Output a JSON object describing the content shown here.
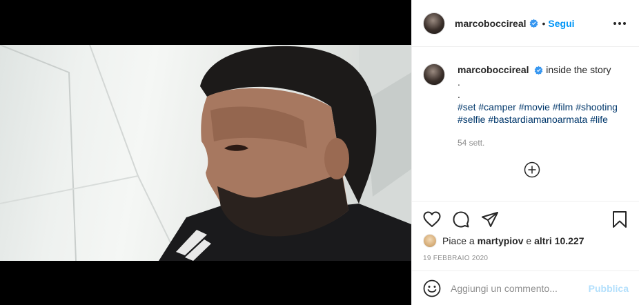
{
  "post": {
    "username": "marcoboccireal",
    "follow_label": "Segui",
    "separator": "•",
    "caption_text": "inside the story",
    "caption_dots": [
      ".",
      "."
    ],
    "hashtags_line1": [
      "#set",
      "#camper",
      "#movie",
      "#film",
      "#shooting"
    ],
    "hashtags_line2": [
      "#selfie",
      "#bastardiamanoarmata",
      "#life"
    ],
    "time_ago": "54 sett.",
    "likes_prefix": "Piace a",
    "likes_user": "martypiov",
    "likes_conj": "e",
    "likes_others": "altri 10.227",
    "date": "19 FEBBRAIO 2020"
  },
  "comment_box": {
    "placeholder": "Aggiungi un commento...",
    "post_label": "Pubblica"
  },
  "icons": {
    "more": "more-options-icon",
    "verified": "verified-badge-icon",
    "load_more": "load-more-comments-icon",
    "like": "heart-icon",
    "comment": "comment-icon",
    "share": "share-icon",
    "save": "bookmark-icon",
    "emoji": "emoji-icon"
  },
  "colors": {
    "link_blue": "#0095f6",
    "hashtag": "#00376b",
    "muted": "#8e8e8e",
    "post_disabled": "#b2dffc"
  }
}
